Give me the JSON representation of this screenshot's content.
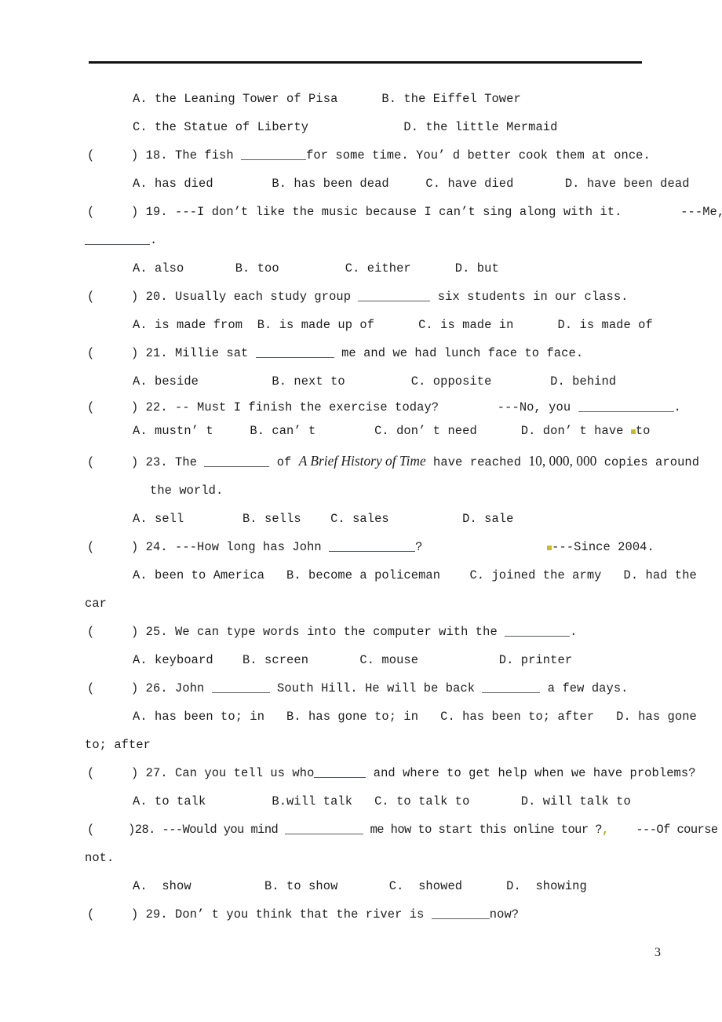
{
  "document": {
    "page_number": "3",
    "header_rule": true
  },
  "questions": [
    {
      "id": "q17-options",
      "type": "options-only",
      "lines": [
        "A. the Leaning Tower of Pisa      B. the Eiffel Tower",
        "C. the Statue of Liberty             D. the little Mermaid"
      ]
    },
    {
      "id": "q18",
      "marker": "(     ) 18. ",
      "stem_pre": "The fish ",
      "stem_post": "for some time. You’ d better cook them at once.",
      "blank": "b-8",
      "options": "A. has died        B. has been dead     C. have died       D. have been dead"
    },
    {
      "id": "q19",
      "marker": "(     ) 19. ",
      "stem": "---I don’t like the music because I can’t sing along with it.        ---Me,",
      "wrap_pre": "",
      "wrap_blank": "b-8",
      "wrap_post": ".",
      "options": "A. also       B. too         C. either      D. but"
    },
    {
      "id": "q20",
      "marker": "(     ) 20. ",
      "stem_pre": "Usually each study group ",
      "stem_post": " six students in our class.",
      "blank": "b-9",
      "options": "A. is made from  B. is made up of      C. is made in      D. is made of"
    },
    {
      "id": "q21",
      "marker": "(     ) 21. ",
      "stem_pre": "Millie sat ",
      "stem_post": " me and we had lunch face to face.",
      "blank": "b-10",
      "options": "A. beside          B. next to         C. opposite        D. behind"
    },
    {
      "id": "q22",
      "marker": "(     ) 22. ",
      "stem_pre": "-- Must I finish the exercise today?        ---No, you ",
      "stem_post": ".",
      "blank": "b-12",
      "options_pre": "A. mustn’ t     B. can’ t        C. don’ t need      D. don’ t have ",
      "options_post": "to",
      "has_mark": true
    },
    {
      "id": "q23",
      "marker": "(     ) 23. ",
      "stem_pre": "The ",
      "blank": "b-8",
      "stem_mid": " of ",
      "title_italic": "A Brief History of Time",
      "stem_mid2": " have reached ",
      "number": "10, 000, 000",
      "stem_post": " copies around",
      "continuation": "the world.",
      "options": "A. sell        B. sells    C. sales          D. sale"
    },
    {
      "id": "q24",
      "marker": "(     ) 24. ",
      "stem_pre": "---How long has John ",
      "blank": "b-11",
      "stem_post": "?                 ",
      "answer": "---Since 2004.",
      "has_mark": true,
      "options": "A. been to America   B. become a policeman    C. joined the army   D. had the",
      "overflow": "car"
    },
    {
      "id": "q25",
      "marker": "(     ) 25. ",
      "stem_pre": "We can type words into the computer with the ",
      "stem_post": ".",
      "blank": "b-8",
      "options": "A. keyboard    B. screen       C. mouse           D. printer"
    },
    {
      "id": "q26",
      "marker": "(     ) 26. ",
      "stem_pre": "John ",
      "stem_mid": " South Hill. He will be back ",
      "stem_post": " a few days.",
      "blank": "b-7",
      "options": "A. has been to; in   B. has gone to; in   C. has been to; after   D. has gone",
      "overflow": "to; after"
    },
    {
      "id": "q27",
      "marker": "(     ) 27. ",
      "stem_pre": "Can you tell us who",
      "stem_post": " and where to get help when we have problems?",
      "blank": "b-6",
      "options": "A. to talk         B.will talk   C. to talk to       D. will talk to"
    },
    {
      "id": "q28",
      "marker": "(     )28. ",
      "stem_pre": "---Would you mind ",
      "blank": "b-10",
      "stem_post": " me how to start this online tour ?",
      "mark_comma": ",",
      "answer": "    ---Of course",
      "overflow": "not.",
      "options": "A.  show          B. to show       C.  showed      D.  showing"
    },
    {
      "id": "q29",
      "marker": "(     ) 29. ",
      "stem_pre": "Don’ t you think that the river is ",
      "stem_post": "now?",
      "blank": "b-7"
    }
  ]
}
